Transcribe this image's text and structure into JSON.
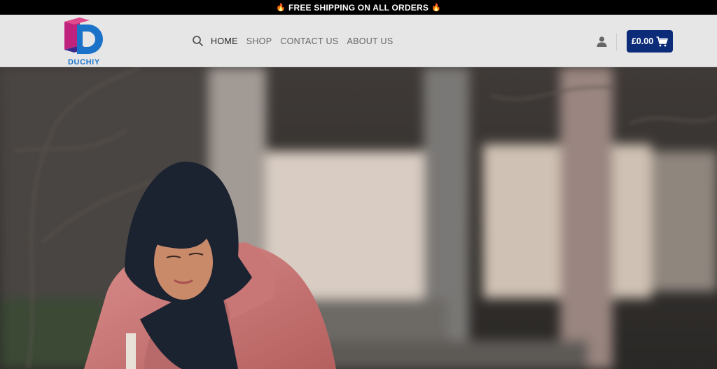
{
  "topbar": {
    "announcement": "FREE SHIPPING ON ALL ORDERS",
    "icon": "fire-icon"
  },
  "header": {
    "logo_text": "DUCHIY",
    "nav": [
      {
        "label": "HOME",
        "active": true
      },
      {
        "label": "SHOP",
        "active": false
      },
      {
        "label": "CONTACT US",
        "active": false
      },
      {
        "label": "ABOUT US",
        "active": false
      }
    ],
    "cart_total": "£0.00"
  },
  "colors": {
    "topbar_bg": "#000000",
    "header_bg": "#e6e6e6",
    "cart_bg": "#0c2c7a",
    "logo_blue": "#1a73c9",
    "logo_magenta": "#c0237e"
  }
}
